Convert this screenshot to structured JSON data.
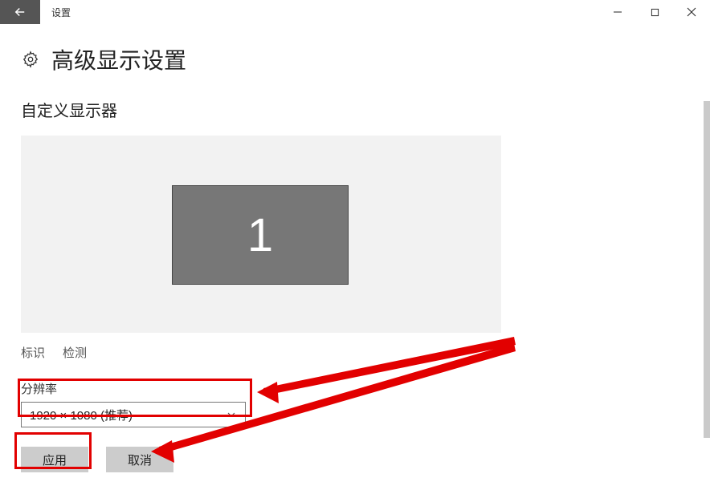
{
  "window": {
    "title": "设置"
  },
  "page": {
    "title": "高级显示设置"
  },
  "section": {
    "title": "自定义显示器"
  },
  "preview": {
    "monitor_number": "1"
  },
  "links": {
    "identify": "标识",
    "detect": "检测"
  },
  "resolution": {
    "label": "分辨率",
    "selected": "1920 × 1080 (推荐)"
  },
  "buttons": {
    "apply": "应用",
    "cancel": "取消"
  }
}
